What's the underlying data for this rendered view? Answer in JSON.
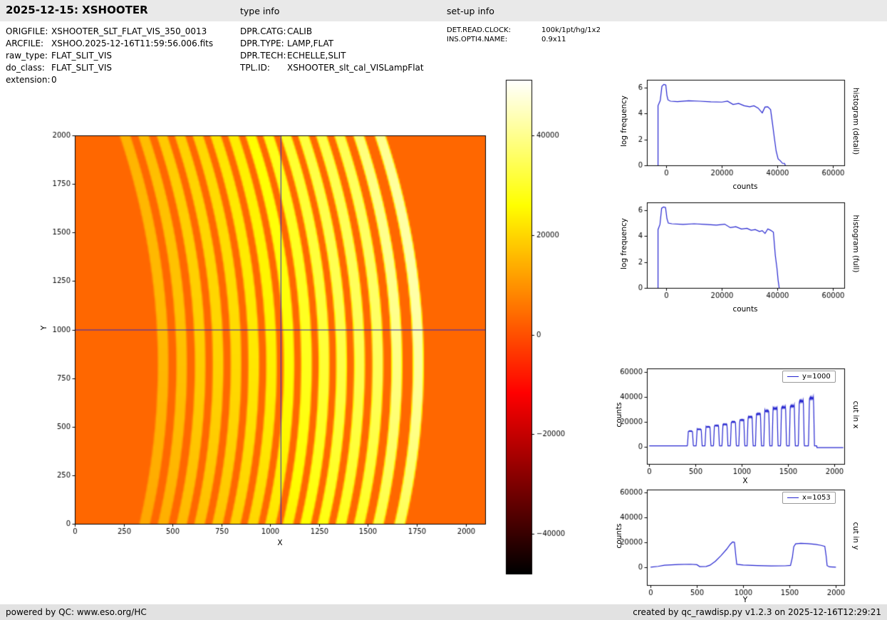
{
  "header": {
    "title": "2025-12-15: XSHOOTER",
    "type_info_label": "type info",
    "setup_info_label": "set-up info"
  },
  "metadata": {
    "file": [
      {
        "label": "ORIGFILE:",
        "value": "XSHOOTER_SLT_FLAT_VIS_350_0013"
      },
      {
        "label": "ARCFILE:",
        "value": "XSHOO.2025-12-16T11:59:56.006.fits"
      },
      {
        "label": "raw_type:",
        "value": "FLAT_SLIT_VIS"
      },
      {
        "label": "do_class:",
        "value": "FLAT_SLIT_VIS"
      },
      {
        "label": "extension:",
        "value": "0"
      }
    ],
    "type": [
      {
        "label": "DPR.CATG:",
        "value": "CALIB"
      },
      {
        "label": "DPR.TYPE:",
        "value": "LAMP,FLAT"
      },
      {
        "label": "DPR.TECH:",
        "value": "ECHELLE,SLIT"
      },
      {
        "label": "TPL.ID:",
        "value": "XSHOOTER_slt_cal_VISLampFlat"
      }
    ],
    "setup": [
      {
        "label": "DET.READ.CLOCK:",
        "value": "100k/1pt/hg/1x2"
      },
      {
        "label": "INS.OPTI4.NAME:",
        "value": "0.9x11"
      }
    ]
  },
  "footer": {
    "left": "powered by QC: www.eso.org/HC",
    "right": "created by qc_rawdisp.py v1.2.3 on 2025-12-16T12:29:21"
  },
  "colors": {
    "header_bg": "#e9e9e9",
    "footer_bg": "#e2e2e2",
    "line_blue": "#2424cf"
  },
  "chart_data": [
    {
      "id": "raw-image",
      "type": "heatmap",
      "description": "XSHOOTER VIS lamp-flat raw frame with curved echelle orders",
      "xlabel": "X",
      "ylabel": "Y",
      "xlim": [
        0,
        2100
      ],
      "ylim": [
        0,
        2000
      ],
      "xticks": [
        0,
        250,
        500,
        750,
        1000,
        1250,
        1500,
        1750,
        2000
      ],
      "yticks": [
        0,
        250,
        500,
        750,
        1000,
        1250,
        1500,
        1750,
        2000
      ],
      "colormap": "hot",
      "clim": [
        -48000,
        51200
      ],
      "background_level": 3500,
      "order_halfwidth": 32,
      "order_taper": 10,
      "curvature": {
        "coeff": -140,
        "y_ref": 820
      },
      "orders": [
        {
          "x": 450,
          "peak": 12000
        },
        {
          "x": 545,
          "peak": 13500
        },
        {
          "x": 640,
          "peak": 15500
        },
        {
          "x": 732,
          "peak": 16500
        },
        {
          "x": 824,
          "peak": 17500
        },
        {
          "x": 915,
          "peak": 19500
        },
        {
          "x": 1006,
          "peak": 21000
        },
        {
          "x": 1096,
          "peak": 23500
        },
        {
          "x": 1186,
          "peak": 26000
        },
        {
          "x": 1276,
          "peak": 28500
        },
        {
          "x": 1366,
          "peak": 30500
        },
        {
          "x": 1458,
          "peak": 31500
        },
        {
          "x": 1552,
          "peak": 32500
        },
        {
          "x": 1650,
          "peak": 36500
        },
        {
          "x": 1760,
          "peak": 39000
        }
      ],
      "crosshair": {
        "x": 1053,
        "y": 1000,
        "color": "#2626cd"
      }
    },
    {
      "id": "colorbar",
      "type": "colorbar",
      "colormap": "hot",
      "clim": [
        -48000,
        51200
      ],
      "ticks": [
        40000,
        20000,
        0,
        -20000,
        -40000
      ]
    },
    {
      "id": "histogram-detail",
      "type": "line",
      "right_label": "histogram (detail)",
      "xlabel": "counts",
      "ylabel": "log frequency",
      "xlim": [
        -7000,
        64000
      ],
      "ylim": [
        0,
        6.6
      ],
      "xticks": [
        0,
        20000,
        40000,
        60000
      ],
      "yticks": [
        0,
        2,
        4,
        6
      ],
      "line_color": "#2424cf",
      "points": [
        [
          -3000,
          0
        ],
        [
          -3000,
          4.6
        ],
        [
          -2200,
          5.0
        ],
        [
          -1600,
          6.1
        ],
        [
          -900,
          6.25
        ],
        [
          -200,
          6.2
        ],
        [
          200,
          5.4
        ],
        [
          600,
          5.05
        ],
        [
          1500,
          4.95
        ],
        [
          4000,
          4.92
        ],
        [
          8000,
          4.98
        ],
        [
          12000,
          4.95
        ],
        [
          16000,
          4.9
        ],
        [
          20000,
          4.88
        ],
        [
          22000,
          4.95
        ],
        [
          24000,
          4.7
        ],
        [
          26000,
          4.78
        ],
        [
          28000,
          4.6
        ],
        [
          30000,
          4.52
        ],
        [
          31500,
          4.6
        ],
        [
          33000,
          4.42
        ],
        [
          34500,
          4.05
        ],
        [
          35500,
          4.5
        ],
        [
          36500,
          4.52
        ],
        [
          37500,
          4.3
        ],
        [
          38200,
          3.2
        ],
        [
          38800,
          2.2
        ],
        [
          39500,
          1.1
        ],
        [
          40200,
          0.5
        ],
        [
          41000,
          0.35
        ],
        [
          41800,
          0.15
        ],
        [
          42500,
          0.15
        ],
        [
          42800,
          0
        ]
      ]
    },
    {
      "id": "histogram-full",
      "type": "line",
      "right_label": "histogram (full)",
      "xlabel": "counts",
      "ylabel": "log frequency",
      "xlim": [
        -7000,
        64000
      ],
      "ylim": [
        0,
        6.6
      ],
      "xticks": [
        0,
        20000,
        40000,
        60000
      ],
      "yticks": [
        0,
        2,
        4,
        6
      ],
      "line_color": "#2424cf",
      "points": [
        [
          -3000,
          0
        ],
        [
          -3000,
          4.5
        ],
        [
          -2300,
          4.9
        ],
        [
          -1700,
          6.15
        ],
        [
          -1000,
          6.25
        ],
        [
          -300,
          6.2
        ],
        [
          200,
          5.35
        ],
        [
          700,
          5.0
        ],
        [
          2000,
          4.95
        ],
        [
          6000,
          4.9
        ],
        [
          10000,
          4.95
        ],
        [
          14000,
          4.9
        ],
        [
          18000,
          4.85
        ],
        [
          21000,
          4.92
        ],
        [
          23000,
          4.65
        ],
        [
          25000,
          4.72
        ],
        [
          27000,
          4.55
        ],
        [
          29000,
          4.6
        ],
        [
          30500,
          4.45
        ],
        [
          32000,
          4.5
        ],
        [
          33500,
          4.35
        ],
        [
          34500,
          4.42
        ],
        [
          35500,
          4.2
        ],
        [
          36500,
          4.55
        ],
        [
          37500,
          4.45
        ],
        [
          38500,
          4.3
        ],
        [
          39200,
          2.5
        ],
        [
          39800,
          1.5
        ],
        [
          40200,
          0.6
        ],
        [
          40600,
          0
        ]
      ]
    },
    {
      "id": "cut-x",
      "type": "line",
      "right_label": "cut in x",
      "legend": "y=1000",
      "xlabel": "X",
      "ylabel": "counts",
      "xlim": [
        -25,
        2110
      ],
      "ylim": [
        -14000,
        63000
      ],
      "xticks": [
        0,
        500,
        1000,
        1500,
        2000
      ],
      "yticks": [
        0,
        20000,
        40000,
        60000
      ],
      "line_color": "#2424cf",
      "baseline": 600,
      "tail_level": -800,
      "points_from": "raw-image orders sampled along y=1000"
    },
    {
      "id": "cut-y",
      "type": "line",
      "right_label": "cut in y",
      "legend": "x=1053",
      "xlabel": "Y",
      "ylabel": "counts",
      "xlim": [
        -40,
        2090
      ],
      "ylim": [
        -14000,
        62000
      ],
      "xticks": [
        0,
        500,
        1000,
        1500,
        2000
      ],
      "yticks": [
        0,
        20000,
        40000,
        60000
      ],
      "line_color": "#2424cf",
      "points": [
        [
          0,
          200
        ],
        [
          80,
          900
        ],
        [
          150,
          1800
        ],
        [
          300,
          2400
        ],
        [
          430,
          2600
        ],
        [
          500,
          2200
        ],
        [
          530,
          700
        ],
        [
          600,
          800
        ],
        [
          640,
          1800
        ],
        [
          700,
          5000
        ],
        [
          760,
          9500
        ],
        [
          820,
          14500
        ],
        [
          860,
          18500
        ],
        [
          885,
          20300
        ],
        [
          905,
          20000
        ],
        [
          920,
          9000
        ],
        [
          930,
          2500
        ],
        [
          1000,
          1900
        ],
        [
          1150,
          1500
        ],
        [
          1300,
          1200
        ],
        [
          1450,
          1300
        ],
        [
          1510,
          1700
        ],
        [
          1530,
          8000
        ],
        [
          1545,
          16500
        ],
        [
          1565,
          18800
        ],
        [
          1620,
          19300
        ],
        [
          1700,
          19000
        ],
        [
          1780,
          18400
        ],
        [
          1840,
          17600
        ],
        [
          1880,
          16800
        ],
        [
          1895,
          9000
        ],
        [
          1905,
          1500
        ],
        [
          1930,
          500
        ],
        [
          2000,
          300
        ]
      ]
    }
  ]
}
